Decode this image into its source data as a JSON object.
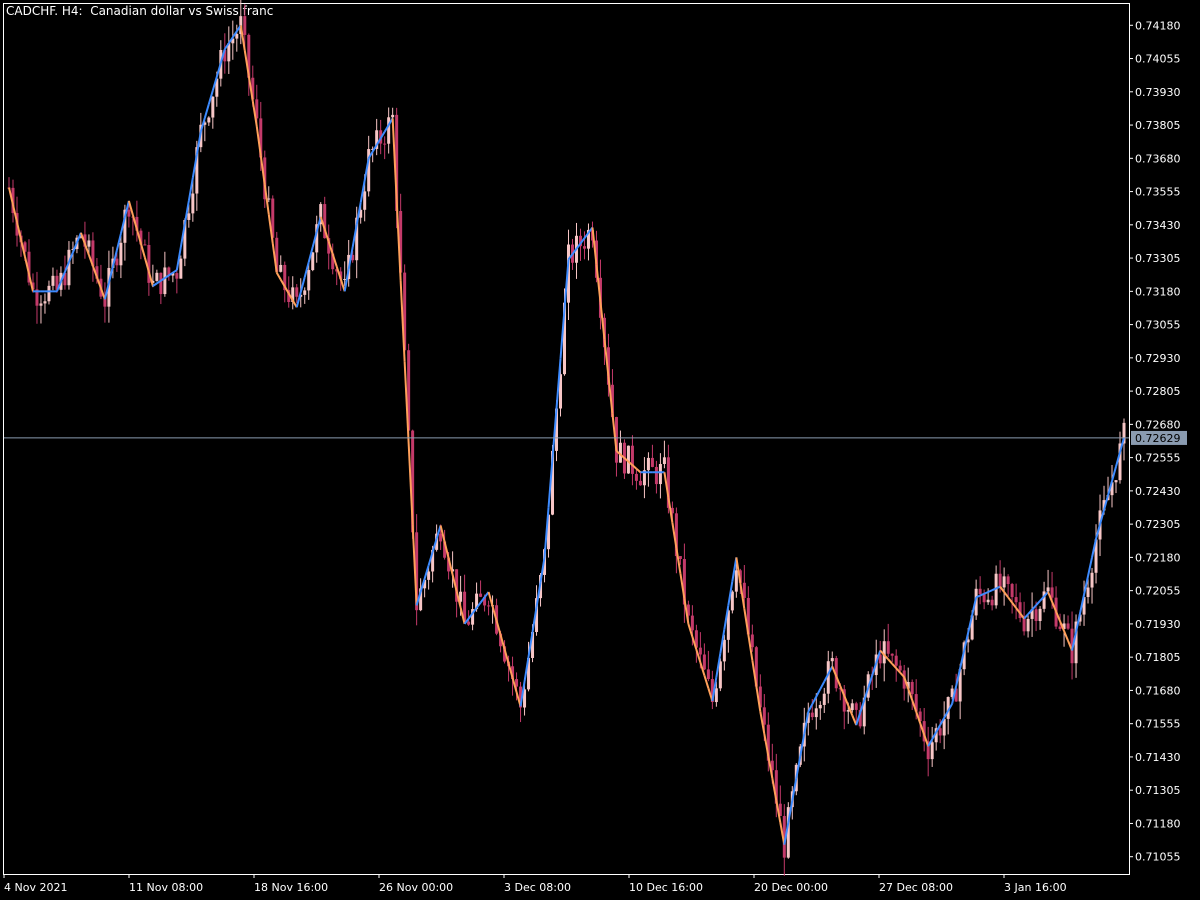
{
  "window": {
    "title_symbol": "CADCHF.",
    "title_timeframe": "H4:",
    "title_description": "Canadian dollar vs Swiss franc"
  },
  "colors": {
    "background": "#000000",
    "frame": "#ffffff",
    "candle_up": "#f7c6c6",
    "candle_down": "#c43a6a",
    "line_rising": "#3d8bff",
    "line_falling": "#ffa05a",
    "current_price_line": "#8a9bb0",
    "current_price_box": "#8a9bb0"
  },
  "chart_data": {
    "type": "candlestick",
    "symbol": "CADCHF.",
    "timeframe": "H4",
    "ylim": [
      0.7099,
      0.7426
    ],
    "y_ticks": [
      "0.74180",
      "0.74055",
      "0.73930",
      "0.73805",
      "0.73680",
      "0.73555",
      "0.73430",
      "0.73305",
      "0.73180",
      "0.73055",
      "0.72930",
      "0.72805",
      "0.72680",
      "0.72555",
      "0.72430",
      "0.72305",
      "0.72180",
      "0.72055",
      "0.71930",
      "0.71805",
      "0.71680",
      "0.71555",
      "0.71430",
      "0.71305",
      "0.71180",
      "0.71055"
    ],
    "x_ticks": [
      "4 Nov 2021",
      "11 Nov 08:00",
      "18 Nov 16:00",
      "26 Nov 00:00",
      "3 Dec 08:00",
      "10 Dec 16:00",
      "20 Dec 00:00",
      "27 Dec 08:00",
      "3 Jan 16:00"
    ],
    "bar_count": 280,
    "current_price": "0.72629",
    "indicator_line": {
      "description": "colored moving average (blue rising, orange falling)",
      "anchors": [
        [
          0,
          0.7357
        ],
        [
          6,
          0.7318
        ],
        [
          12,
          0.7318
        ],
        [
          18,
          0.734
        ],
        [
          24,
          0.7315
        ],
        [
          30,
          0.7352
        ],
        [
          36,
          0.732
        ],
        [
          42,
          0.7326
        ],
        [
          48,
          0.7378
        ],
        [
          54,
          0.7409
        ],
        [
          58,
          0.7418
        ],
        [
          62,
          0.738
        ],
        [
          67,
          0.7325
        ],
        [
          72,
          0.7312
        ],
        [
          78,
          0.7346
        ],
        [
          84,
          0.7318
        ],
        [
          90,
          0.7368
        ],
        [
          96,
          0.7383
        ],
        [
          102,
          0.72
        ],
        [
          108,
          0.723
        ],
        [
          114,
          0.7193
        ],
        [
          120,
          0.7205
        ],
        [
          128,
          0.7162
        ],
        [
          134,
          0.7218
        ],
        [
          140,
          0.733
        ],
        [
          146,
          0.7342
        ],
        [
          152,
          0.7258
        ],
        [
          158,
          0.725
        ],
        [
          164,
          0.725
        ],
        [
          170,
          0.7193
        ],
        [
          176,
          0.7164
        ],
        [
          182,
          0.7218
        ],
        [
          188,
          0.716
        ],
        [
          194,
          0.711
        ],
        [
          200,
          0.716
        ],
        [
          206,
          0.7177
        ],
        [
          212,
          0.7155
        ],
        [
          218,
          0.7183
        ],
        [
          224,
          0.7173
        ],
        [
          230,
          0.7147
        ],
        [
          236,
          0.7163
        ],
        [
          242,
          0.7203
        ],
        [
          248,
          0.7207
        ],
        [
          254,
          0.7195
        ],
        [
          260,
          0.7205
        ],
        [
          266,
          0.7183
        ],
        [
          272,
          0.7225
        ],
        [
          279,
          0.7263
        ]
      ]
    }
  }
}
